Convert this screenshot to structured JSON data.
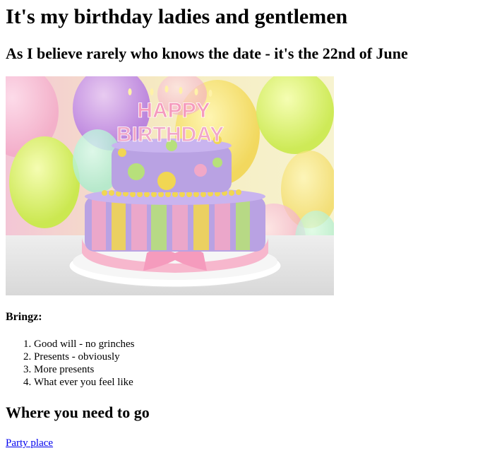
{
  "page": {
    "heading": "It's my birthday ladies and gentlemen",
    "subheading": "As I believe rarely who knows the date - it's the 22nd of June",
    "image": {
      "alt": "birthday cake",
      "cake_text_top": "HAPPY",
      "cake_text_bottom": "BIRTHDAY"
    },
    "bringz_label": "Bringz:",
    "bringz_items": [
      "Good will - no grinches",
      "Presents - obviously",
      "More presents",
      "What ever you feel like"
    ],
    "where_heading": "Where you need to go",
    "link_text": "Party place",
    "colors": {
      "link": "#0000ee",
      "text": "#000000"
    }
  }
}
